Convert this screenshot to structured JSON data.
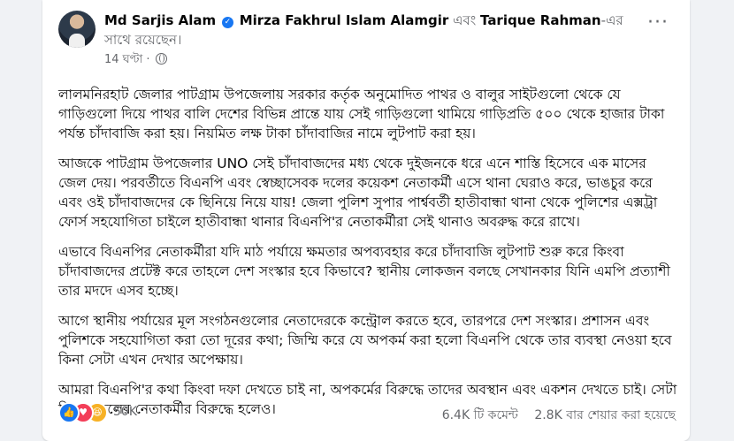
{
  "post": {
    "author": "Md Sarjis Alam",
    "tagged_1": "Mirza Fakhrul Islam Alamgir",
    "conjunction": " এবং ",
    "tagged_2": "Tarique Rahman",
    "with_suffix": "-এর সাথে রয়েছেন।",
    "time": "14 ঘণ্টা",
    "icons": {
      "verified": "verified-badge-icon",
      "audience": "globe-icon",
      "menu": "more-icon"
    },
    "paragraphs": [
      "লালমনিরহাট জেলার পাটগ্রাম উপজেলায় সরকার কর্তৃক অনুমোদিত পাথর ও বালুর সাইটগুলো থেকে যে গাড়িগুলো দিয়ে পাথর বালি দেশের বিভিন্ন প্রান্তে যায় সেই গাড়িগুলো থামিয়ে গাড়িপ্রতি ৫০০ থেকে হাজার টাকা পর্যন্ত চাঁদাবাজি করা হয়। নিয়মিত লক্ষ টাকা চাঁদাবাজির নামে লুটপাট করা হয়।",
      "আজকে পাটগ্রাম উপজেলার UNO সেই চাঁদাবাজদের মধ্য থেকে দুইজনকে ধরে এনে শাস্তি হিসেবে এক মাসের জেল দেয়। পরবর্তীতে বিএনপি এবং স্বেচ্ছাসেবক দলের কয়েকশ নেতাকর্মী এসে থানা ঘেরাও করে, ভাঙচুর করে এবং ওই চাঁদাবাজদের কে ছিনিয়ে নিয়ে যায়! জেলা পুলিশ সুপার পার্শ্ববর্তী হাতীবান্ধা থানা থেকে পুলিশের এক্সট্রা ফোর্স সহযোগিতা চাইলে হাতীবান্ধা থানার বিএনপি'র নেতাকর্মীরা সেই থানাও অবরুদ্ধ করে রাখে।",
      "এভাবে বিএনপির নেতাকর্মীরা যদি মাঠ পর্যায়ে ক্ষমতার অপব্যবহার করে চাঁদাবাজি লুটপাট শুরু করে কিংবা চাঁদাবাজদের প্রটেক্ট করে তাহলে দেশ সংস্কার হবে কিভাবে? স্থানীয় লোকজন বলছে সেখানকার যিনি এমপি প্রত্যাশী তার মদদে এসব হচ্ছে।",
      "আগে স্থানীয় পর্যায়ের মূল সংগঠনগুলোর নেতাদেরকে কন্ট্রোল করতে হবে, তারপরে দেশ সংস্কার। প্রশাসন এবং পুলিশকে সহযোগিতা করা তো দূরের কথা; জিম্মি করে যে অপকর্ম করা হলো বিএনপি থেকে তার ব্যবস্থা নেওয়া হবে কিনা সেটা এখন দেখার অপেক্ষায়।",
      "আমরা বিএনপি'র কথা কিংবা দফা দেখতে চাই না, অপকর্মের বিরুদ্ধে তাদের অবস্থান এবং একশন দেখতে চাই। সেটা নিজের দলের নেতাকর্মীর বিরুদ্ধে হলেও।"
    ],
    "reactions": {
      "count": "50K",
      "types": [
        "like-icon",
        "love-icon",
        "haha-icon"
      ]
    },
    "comments": "6.4K টি কমেন্ট",
    "shares": "2.8K বার শেয়ার করা হয়েছে"
  },
  "colors": {
    "link": "#050505",
    "secondary": "#65676b",
    "like": "#1877f2",
    "love": "#f33e58",
    "haha": "#f7b125"
  }
}
